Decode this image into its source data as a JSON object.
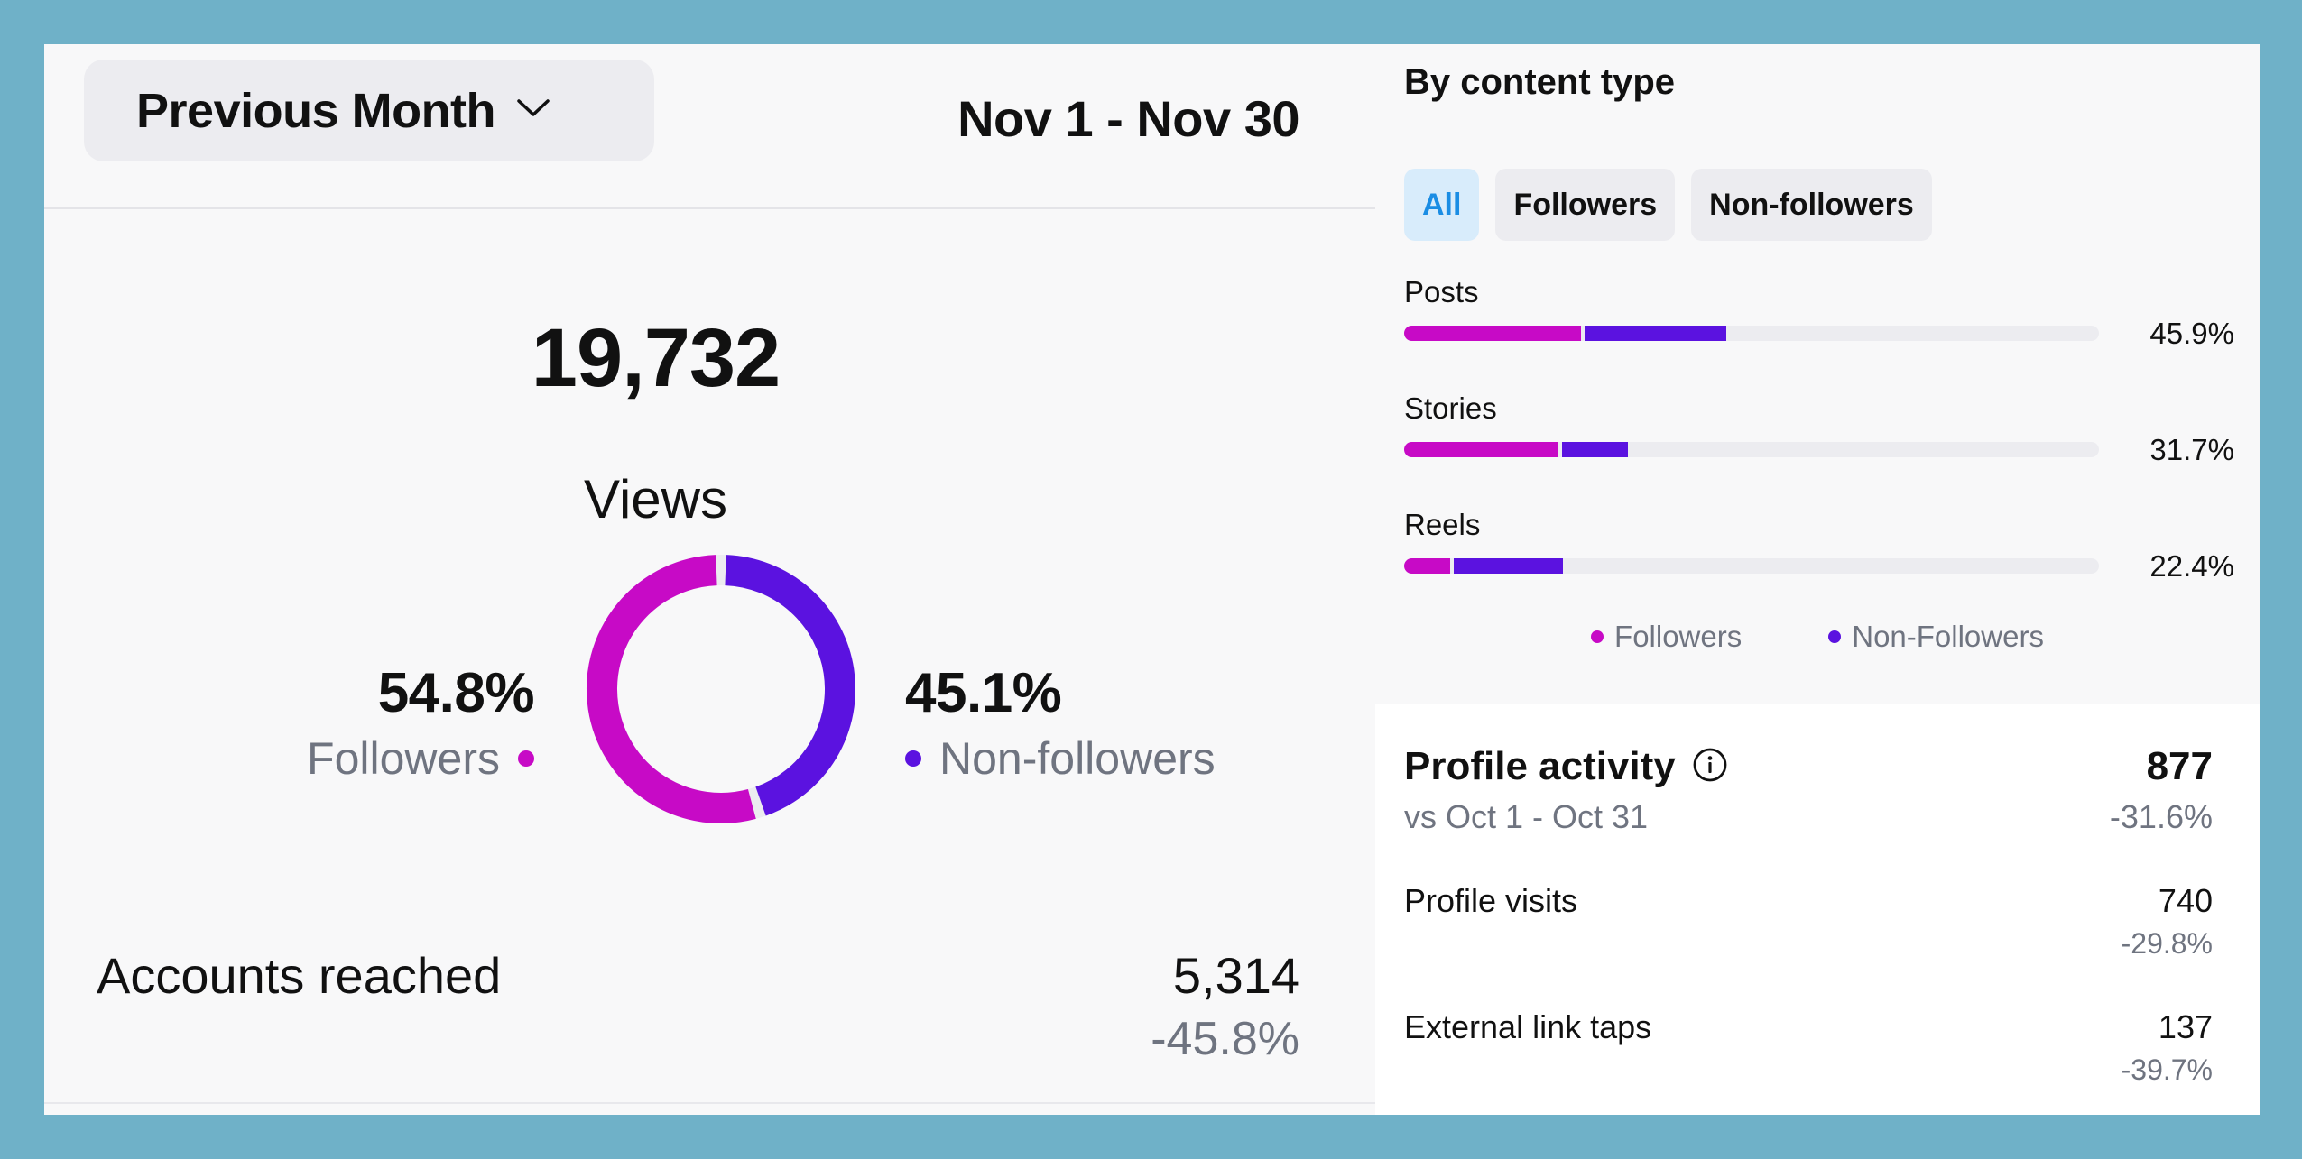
{
  "overview": {
    "period_label": "Previous Month",
    "date_range": "Nov 1 - Nov 30",
    "views_value": "19,732",
    "views_label": "Views",
    "followers_pct": "54.8%",
    "followers_label": "Followers",
    "nonfollowers_pct": "45.1%",
    "nonfollowers_label": "Non-followers",
    "donut_followers_fraction": 0.548,
    "accounts_reached_label": "Accounts reached",
    "accounts_reached_value": "5,314",
    "accounts_reached_delta": "-45.8%"
  },
  "content_type": {
    "title": "By content type",
    "filters": [
      {
        "label": "All",
        "active": true
      },
      {
        "label": "Followers",
        "active": false
      },
      {
        "label": "Non-followers",
        "active": false
      }
    ],
    "rows": [
      {
        "name": "Posts",
        "pct": "45.9%",
        "followers_share": 0.255,
        "nonfollowers_share": 0.204
      },
      {
        "name": "Stories",
        "pct": "31.7%",
        "followers_share": 0.222,
        "nonfollowers_share": 0.095
      },
      {
        "name": "Reels",
        "pct": "22.4%",
        "followers_share": 0.066,
        "nonfollowers_share": 0.158
      }
    ],
    "legend": {
      "followers": "Followers",
      "nonfollowers": "Non-Followers"
    }
  },
  "profile_activity": {
    "title": "Profile activity",
    "comparison": "vs Oct 1 - Oct 31",
    "value": "877",
    "delta": "-31.6%",
    "metrics": [
      {
        "label": "Profile visits",
        "value": "740",
        "delta": "-29.8%"
      },
      {
        "label": "External link taps",
        "value": "137",
        "delta": "-39.7%"
      }
    ]
  },
  "colors": {
    "followers": "#c70ac6",
    "nonfollowers": "#5b12e0",
    "accent": "#1a8de4",
    "frame": "#6fb1c8"
  },
  "icons": {
    "dropdown": "chevron-down-icon",
    "info": "info-icon"
  }
}
